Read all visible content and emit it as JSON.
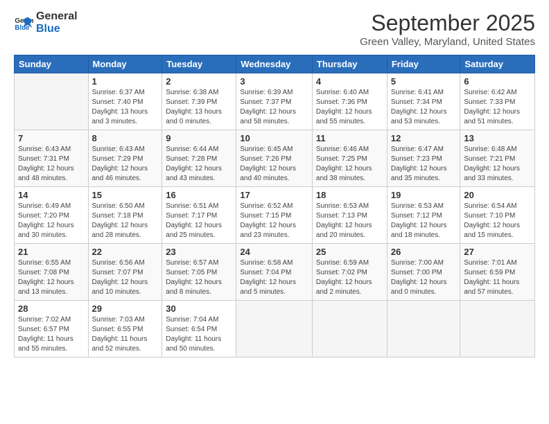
{
  "header": {
    "logo_general": "General",
    "logo_blue": "Blue",
    "title": "September 2025",
    "subtitle": "Green Valley, Maryland, United States"
  },
  "days_of_week": [
    "Sunday",
    "Monday",
    "Tuesday",
    "Wednesday",
    "Thursday",
    "Friday",
    "Saturday"
  ],
  "weeks": [
    [
      {
        "day": "",
        "info": ""
      },
      {
        "day": "1",
        "info": "Sunrise: 6:37 AM\nSunset: 7:40 PM\nDaylight: 13 hours\nand 3 minutes."
      },
      {
        "day": "2",
        "info": "Sunrise: 6:38 AM\nSunset: 7:39 PM\nDaylight: 13 hours\nand 0 minutes."
      },
      {
        "day": "3",
        "info": "Sunrise: 6:39 AM\nSunset: 7:37 PM\nDaylight: 12 hours\nand 58 minutes."
      },
      {
        "day": "4",
        "info": "Sunrise: 6:40 AM\nSunset: 7:36 PM\nDaylight: 12 hours\nand 55 minutes."
      },
      {
        "day": "5",
        "info": "Sunrise: 6:41 AM\nSunset: 7:34 PM\nDaylight: 12 hours\nand 53 minutes."
      },
      {
        "day": "6",
        "info": "Sunrise: 6:42 AM\nSunset: 7:33 PM\nDaylight: 12 hours\nand 51 minutes."
      }
    ],
    [
      {
        "day": "7",
        "info": "Sunrise: 6:43 AM\nSunset: 7:31 PM\nDaylight: 12 hours\nand 48 minutes."
      },
      {
        "day": "8",
        "info": "Sunrise: 6:43 AM\nSunset: 7:29 PM\nDaylight: 12 hours\nand 46 minutes."
      },
      {
        "day": "9",
        "info": "Sunrise: 6:44 AM\nSunset: 7:28 PM\nDaylight: 12 hours\nand 43 minutes."
      },
      {
        "day": "10",
        "info": "Sunrise: 6:45 AM\nSunset: 7:26 PM\nDaylight: 12 hours\nand 40 minutes."
      },
      {
        "day": "11",
        "info": "Sunrise: 6:46 AM\nSunset: 7:25 PM\nDaylight: 12 hours\nand 38 minutes."
      },
      {
        "day": "12",
        "info": "Sunrise: 6:47 AM\nSunset: 7:23 PM\nDaylight: 12 hours\nand 35 minutes."
      },
      {
        "day": "13",
        "info": "Sunrise: 6:48 AM\nSunset: 7:21 PM\nDaylight: 12 hours\nand 33 minutes."
      }
    ],
    [
      {
        "day": "14",
        "info": "Sunrise: 6:49 AM\nSunset: 7:20 PM\nDaylight: 12 hours\nand 30 minutes."
      },
      {
        "day": "15",
        "info": "Sunrise: 6:50 AM\nSunset: 7:18 PM\nDaylight: 12 hours\nand 28 minutes."
      },
      {
        "day": "16",
        "info": "Sunrise: 6:51 AM\nSunset: 7:17 PM\nDaylight: 12 hours\nand 25 minutes."
      },
      {
        "day": "17",
        "info": "Sunrise: 6:52 AM\nSunset: 7:15 PM\nDaylight: 12 hours\nand 23 minutes."
      },
      {
        "day": "18",
        "info": "Sunrise: 6:53 AM\nSunset: 7:13 PM\nDaylight: 12 hours\nand 20 minutes."
      },
      {
        "day": "19",
        "info": "Sunrise: 6:53 AM\nSunset: 7:12 PM\nDaylight: 12 hours\nand 18 minutes."
      },
      {
        "day": "20",
        "info": "Sunrise: 6:54 AM\nSunset: 7:10 PM\nDaylight: 12 hours\nand 15 minutes."
      }
    ],
    [
      {
        "day": "21",
        "info": "Sunrise: 6:55 AM\nSunset: 7:08 PM\nDaylight: 12 hours\nand 13 minutes."
      },
      {
        "day": "22",
        "info": "Sunrise: 6:56 AM\nSunset: 7:07 PM\nDaylight: 12 hours\nand 10 minutes."
      },
      {
        "day": "23",
        "info": "Sunrise: 6:57 AM\nSunset: 7:05 PM\nDaylight: 12 hours\nand 8 minutes."
      },
      {
        "day": "24",
        "info": "Sunrise: 6:58 AM\nSunset: 7:04 PM\nDaylight: 12 hours\nand 5 minutes."
      },
      {
        "day": "25",
        "info": "Sunrise: 6:59 AM\nSunset: 7:02 PM\nDaylight: 12 hours\nand 2 minutes."
      },
      {
        "day": "26",
        "info": "Sunrise: 7:00 AM\nSunset: 7:00 PM\nDaylight: 12 hours\nand 0 minutes."
      },
      {
        "day": "27",
        "info": "Sunrise: 7:01 AM\nSunset: 6:59 PM\nDaylight: 11 hours\nand 57 minutes."
      }
    ],
    [
      {
        "day": "28",
        "info": "Sunrise: 7:02 AM\nSunset: 6:57 PM\nDaylight: 11 hours\nand 55 minutes."
      },
      {
        "day": "29",
        "info": "Sunrise: 7:03 AM\nSunset: 6:55 PM\nDaylight: 11 hours\nand 52 minutes."
      },
      {
        "day": "30",
        "info": "Sunrise: 7:04 AM\nSunset: 6:54 PM\nDaylight: 11 hours\nand 50 minutes."
      },
      {
        "day": "",
        "info": ""
      },
      {
        "day": "",
        "info": ""
      },
      {
        "day": "",
        "info": ""
      },
      {
        "day": "",
        "info": ""
      }
    ]
  ]
}
